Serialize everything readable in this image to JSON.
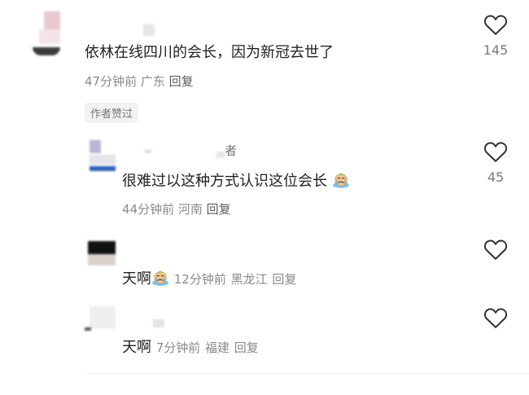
{
  "comments": [
    {
      "text": "依林在线四川的会长，因为新冠去世了",
      "time": "47分钟前",
      "location": "广东",
      "reply": "回复",
      "likes": "145",
      "badge": "作者赞过"
    },
    {
      "name_suffix": "者",
      "text": "很难过以这种方式认识这位会长",
      "time": "44分钟前",
      "location": "河南",
      "reply": "回复",
      "likes": "45"
    },
    {
      "text": "天啊",
      "time": "12分钟前",
      "location": "黑龙江",
      "reply": "回复"
    },
    {
      "text": "天啊",
      "time": "7分钟前",
      "location": "福建",
      "reply": "回复"
    }
  ],
  "icons": {
    "like": "heart-outline-icon",
    "emoji": "crying-emoji-icon"
  },
  "colors": {
    "meta": "#8a8a8a",
    "heart": "#333333",
    "badge_bg": "#f2f2f2"
  }
}
